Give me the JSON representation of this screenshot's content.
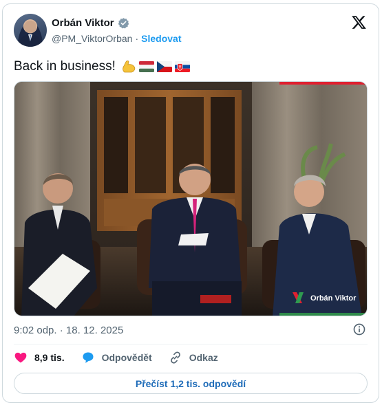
{
  "author": {
    "name": "Orbán Viktor",
    "handle": "@PM_ViktorOrban",
    "separator": "·",
    "follow_label": "Sledovat"
  },
  "tweet": {
    "text": "Back in business!",
    "emojis": [
      "flexed-biceps",
      "flag-hungary",
      "flag-czech-republic",
      "flag-slovakia"
    ]
  },
  "media": {
    "watermark": "Orbán Viktor"
  },
  "meta": {
    "time": "9:02 odp.",
    "separator": "·",
    "date": "18. 12. 2025"
  },
  "actions": {
    "likes": "8,9 tis.",
    "reply_label": "Odpovědět",
    "link_label": "Odkaz"
  },
  "read_replies_label": "Přečíst 1,2 tis. odpovědí",
  "colors": {
    "accent": "#1d9bf0",
    "like": "#f91880",
    "text": "#0f1419",
    "muted": "#536471",
    "border": "#cfd9de"
  }
}
